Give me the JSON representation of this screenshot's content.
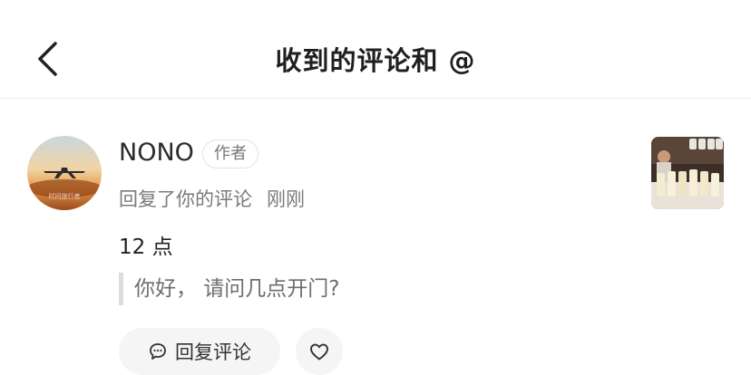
{
  "header": {
    "title": "收到的评论和 @",
    "back_icon": "chevron-left-icon"
  },
  "comment": {
    "user_name": "NONO",
    "author_badge": "作者",
    "action": "回复了你的评论",
    "time": "刚刚",
    "reply_text": "12 点",
    "quoted_text": "你好， 请问几点开门?",
    "reply_button_label": "回复评论",
    "reply_icon": "chat-bubble-icon",
    "like_icon": "heart-icon",
    "avatar_caption": "时间旅行者"
  },
  "colors": {
    "text_primary": "#222222",
    "text_secondary": "#7a7a7a",
    "button_bg": "#f5f5f5",
    "divider": "#ececec"
  }
}
